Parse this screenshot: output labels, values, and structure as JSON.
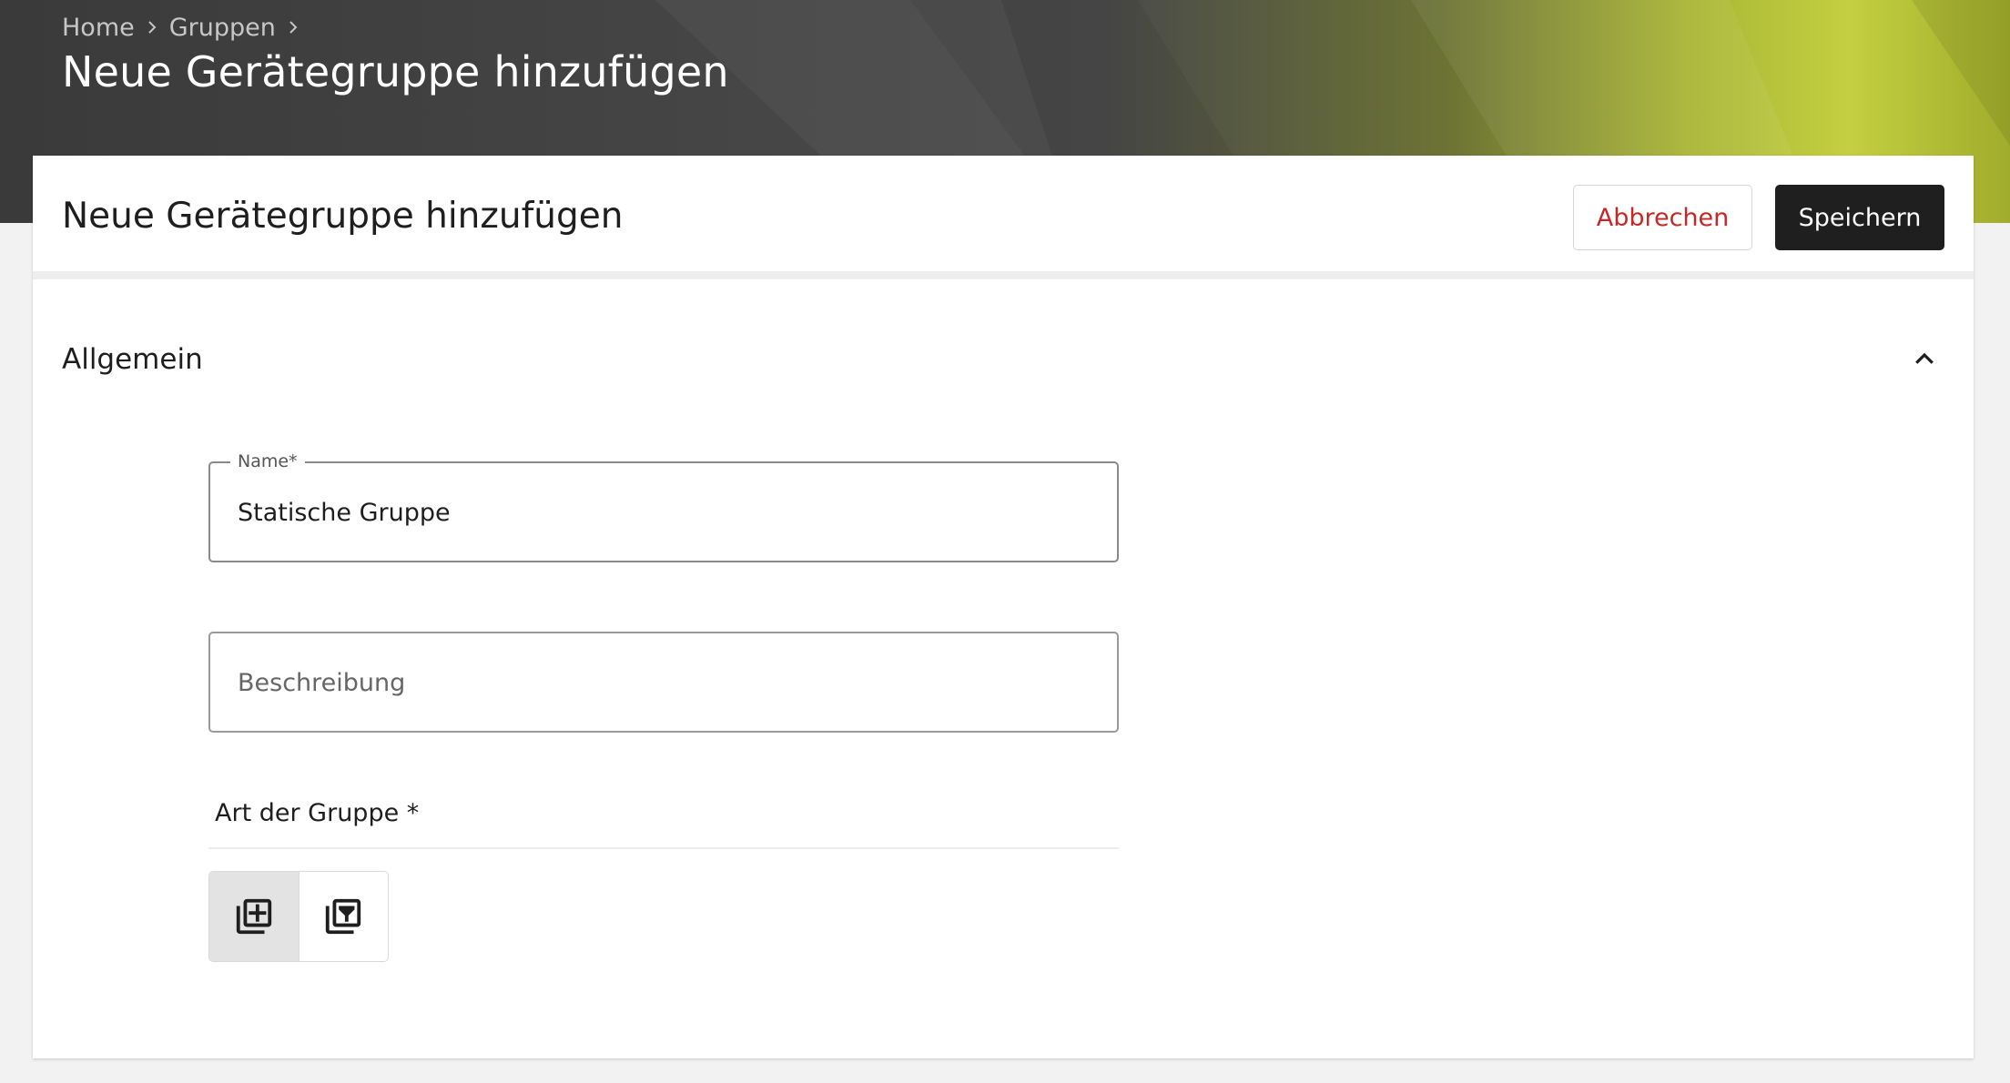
{
  "breadcrumb": {
    "items": [
      "Home",
      "Gruppen"
    ]
  },
  "header": {
    "title": "Neue Gerätegruppe hinzufügen"
  },
  "card": {
    "title": "Neue Gerätegruppe hinzufügen",
    "cancel_label": "Abbrechen",
    "save_label": "Speichern"
  },
  "section": {
    "title": "Allgemein",
    "collapse_icon": "chevron-up-icon"
  },
  "form": {
    "name": {
      "label": "Name*",
      "value": "Statische Gruppe"
    },
    "description": {
      "placeholder": "Beschreibung",
      "value": ""
    },
    "group_type": {
      "label": "Art der Gruppe *",
      "options": [
        {
          "icon": "library-add-icon",
          "selected": true
        },
        {
          "icon": "filter-library-icon",
          "selected": false
        }
      ]
    }
  },
  "colors": {
    "accent_green": "#c4d040",
    "header_dark": "#3a3a3a",
    "save_button": "#1f1f1f",
    "cancel_text": "#c62828"
  }
}
